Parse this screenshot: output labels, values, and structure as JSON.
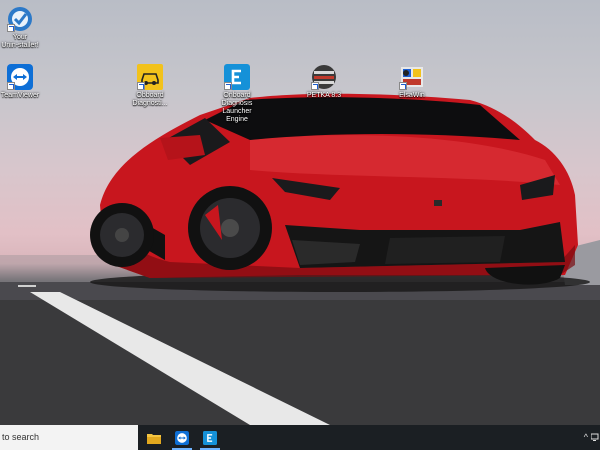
{
  "desktop": {
    "icons": [
      {
        "name": "your-uninstaller",
        "label_lines": [
          "Your",
          "Unin-staller!"
        ]
      },
      {
        "name": "teamviewer",
        "label_lines": [
          "TeamViewer"
        ]
      },
      {
        "name": "obd-diagnosis",
        "label_lines": [
          "Obboard",
          "Diagnosti..."
        ]
      },
      {
        "name": "obd-launcher-engine",
        "label_lines": [
          "Onboard",
          "Diagnosis",
          "Launcher",
          "Engine"
        ]
      },
      {
        "name": "petka",
        "label_lines": [
          "PETKA 8.3"
        ]
      },
      {
        "name": "elsawin",
        "label_lines": [
          "ElsaWin"
        ]
      }
    ]
  },
  "taskbar": {
    "search_placeholder": "to search",
    "apps": [
      {
        "name": "file-explorer",
        "active": true
      },
      {
        "name": "teamviewer",
        "active": true
      },
      {
        "name": "obd-launcher",
        "active": true
      }
    ],
    "tray_chevron": "^"
  },
  "colors": {
    "car_red": "#c8161e",
    "taskbar": "#1b1f23",
    "teamviewer_blue": "#0e6fd6",
    "launcher_blue": "#1591d8",
    "obd_yellow": "#f2c21b"
  }
}
